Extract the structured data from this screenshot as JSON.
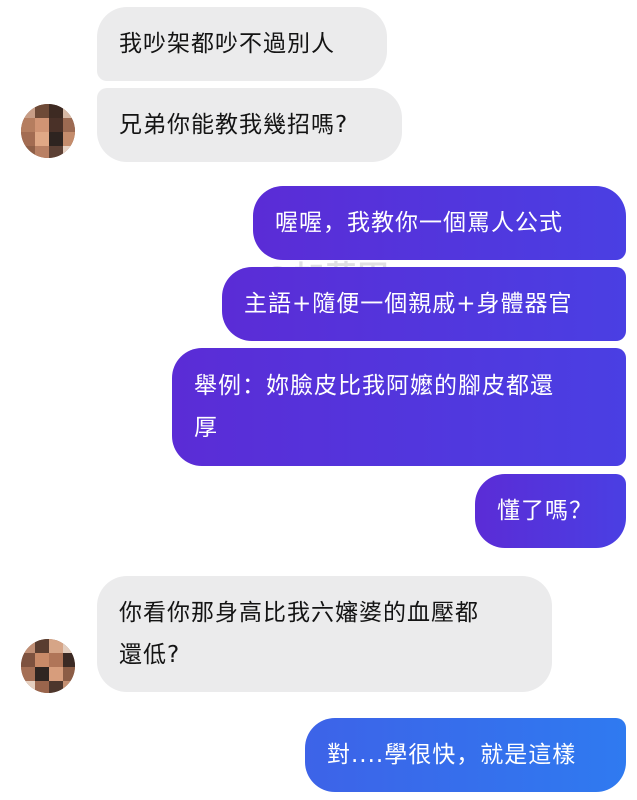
{
  "thread": {
    "messages": [
      {
        "sender": "them",
        "lines": [
          "我吵架都吵不過別人"
        ]
      },
      {
        "sender": "them",
        "lines": [
          "兄弟你能教我幾招嗎?"
        ]
      },
      {
        "sender": "me",
        "lines": [
          "喔喔，我教你一個罵人公式"
        ]
      },
      {
        "sender": "me",
        "lines": [
          "主語+隨便一個親戚+身體器官"
        ]
      },
      {
        "sender": "me",
        "lines": [
          "舉例：妳臉皮比我阿嬤的腳皮都還",
          "厚"
        ]
      },
      {
        "sender": "me",
        "lines": [
          "懂了嗎？"
        ]
      },
      {
        "sender": "them",
        "lines": [
          "你看你那身高比我六嬸婆的血壓都",
          "還低?"
        ]
      },
      {
        "sender": "me",
        "lines": [
          "對....學很快，就是這樣"
        ]
      }
    ]
  },
  "watermarks": [
    "@加藤軍",
    "@加藤軍"
  ],
  "colors": {
    "incoming_bubble": "#ebebec",
    "outgoing_bubble": "#5b2cd6",
    "outgoing_bubble_latest": "#3d63e8",
    "incoming_text": "#141414",
    "outgoing_text": "#ffffff"
  },
  "icons": {
    "contact_avatar": "pixelated-face-avatar"
  }
}
